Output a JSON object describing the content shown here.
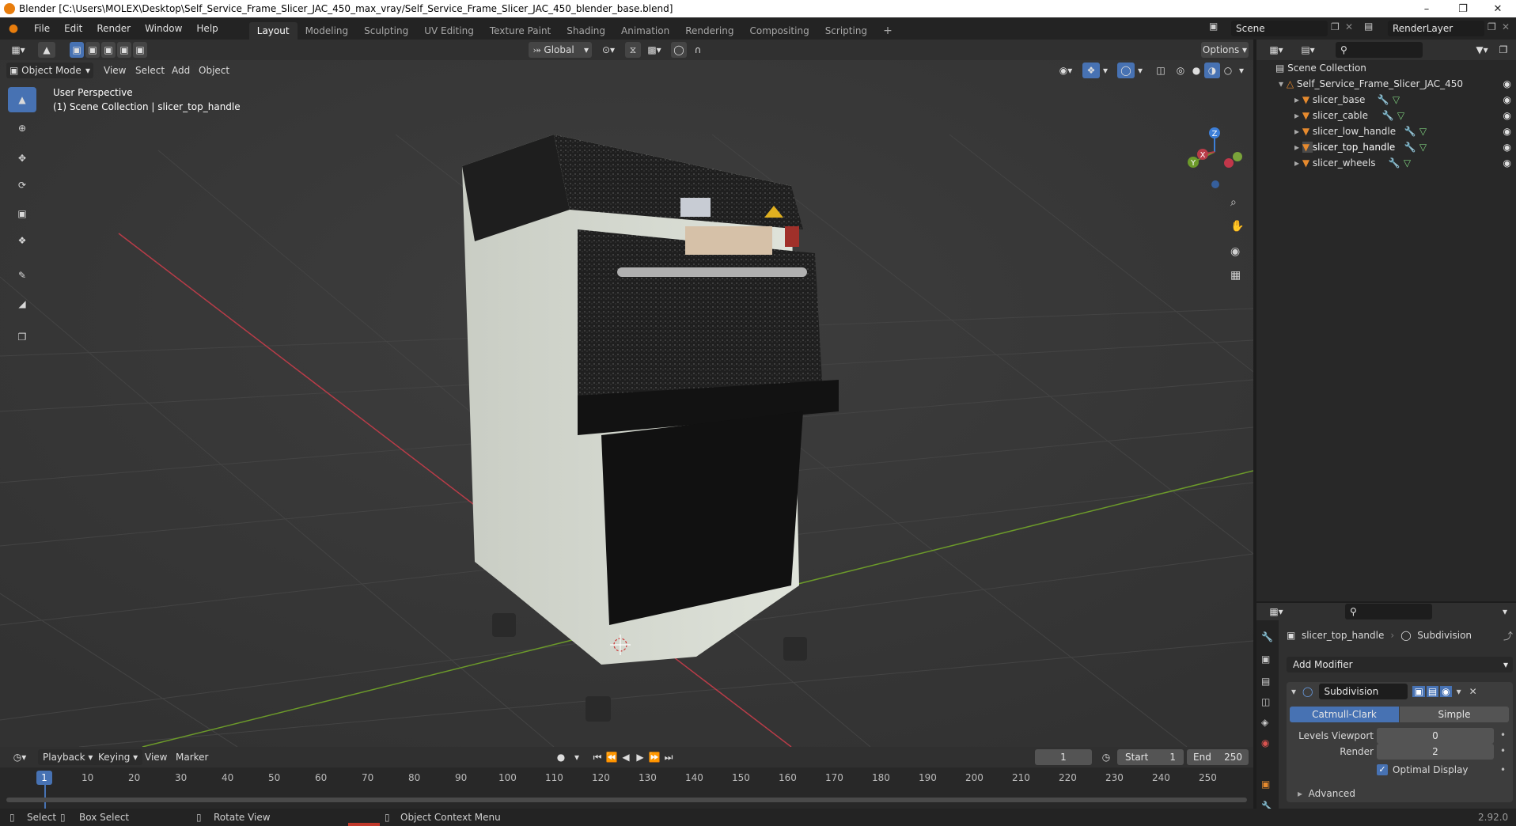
{
  "title_bar": {
    "text": "Blender [C:\\Users\\MOLEX\\Desktop\\Self_Service_Frame_Slicer_JAC_450_max_vray/Self_Service_Frame_Slicer_JAC_450_blender_base.blend]"
  },
  "menu": {
    "items": [
      "File",
      "Edit",
      "Render",
      "Window",
      "Help"
    ]
  },
  "workspaces": {
    "tabs": [
      "Layout",
      "Modeling",
      "Sculpting",
      "UV Editing",
      "Texture Paint",
      "Shading",
      "Animation",
      "Rendering",
      "Compositing",
      "Scripting"
    ],
    "active": "Layout"
  },
  "scene": {
    "name": "Scene",
    "render_layer": "RenderLayer"
  },
  "viewport_header": {
    "transform_orientation": "Global",
    "options_label": "Options",
    "mode": "Object Mode",
    "menus": [
      "View",
      "Select",
      "Add",
      "Object"
    ]
  },
  "viewport": {
    "perspective_label": "User Perspective",
    "context_label": "(1) Scene Collection | slicer_top_handle",
    "gizmo": {
      "x": "X",
      "y": "Y",
      "z": "Z"
    }
  },
  "outliner": {
    "root": "Scene Collection",
    "collection": "Self_Service_Frame_Slicer_JAC_450",
    "objects": [
      "slicer_base",
      "slicer_cable",
      "slicer_low_handle",
      "slicer_top_handle",
      "slicer_wheels"
    ]
  },
  "properties": {
    "object_name": "slicer_top_handle",
    "modifier_context": "Subdivision",
    "add_modifier_label": "Add Modifier",
    "modifier_name": "Subdivision",
    "mode_catmull": "Catmull-Clark",
    "mode_simple": "Simple",
    "levels_viewport_label": "Levels Viewport",
    "levels_viewport_value": "0",
    "render_label": "Render",
    "render_value": "2",
    "optimal_display_label": "Optimal Display",
    "advanced_label": "Advanced"
  },
  "timeline": {
    "menus": [
      "Playback",
      "Keying",
      "View",
      "Marker"
    ],
    "current_frame": "1",
    "start_label": "Start",
    "start_value": "1",
    "end_label": "End",
    "end_value": "250",
    "ticks": [
      "1",
      "10",
      "20",
      "30",
      "40",
      "50",
      "60",
      "70",
      "80",
      "90",
      "100",
      "110",
      "120",
      "130",
      "140",
      "150",
      "160",
      "170",
      "180",
      "190",
      "200",
      "210",
      "220",
      "230",
      "240",
      "250"
    ]
  },
  "status_bar": {
    "select": "Select",
    "box_select": "Box Select",
    "rotate_view": "Rotate View",
    "context_menu": "Object Context Menu",
    "version": "2.92.0"
  },
  "colors": {
    "accent": "#4772b3",
    "x_axis": "#b83c48",
    "y_axis": "#6c9a2a",
    "z_axis": "#3d7fd8",
    "object_orange": "#e68a2e"
  }
}
